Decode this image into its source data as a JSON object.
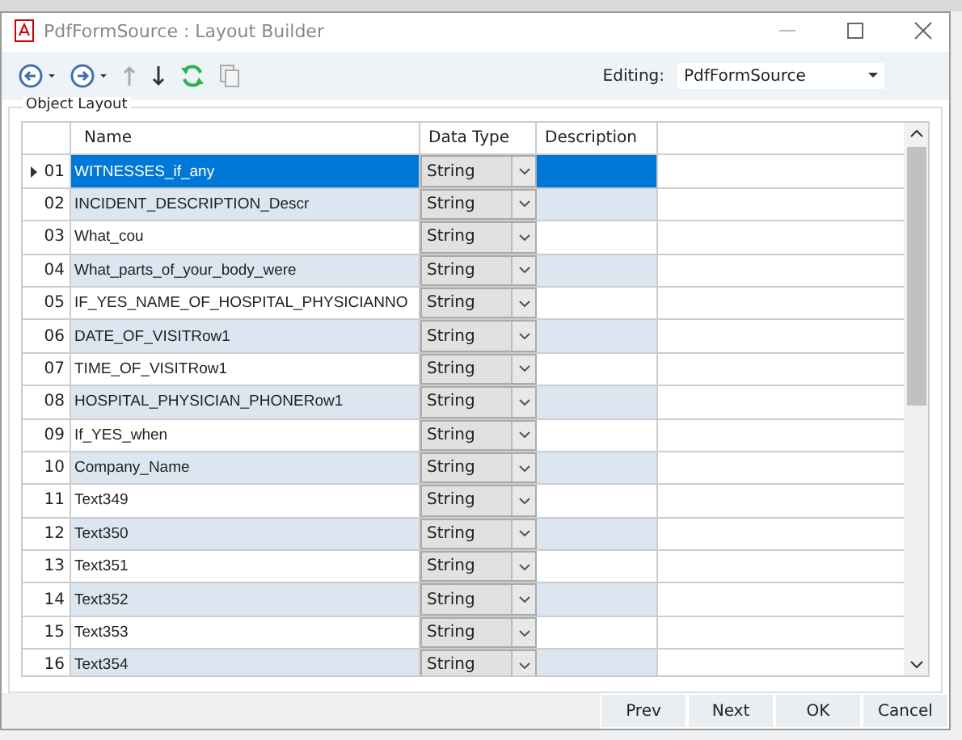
{
  "window": {
    "title": "PdfFormSource : Layout Builder"
  },
  "editing": {
    "label": "Editing:",
    "value": "PdfFormSource"
  },
  "group": {
    "title": "Object Layout"
  },
  "table": {
    "columns": [
      "Name",
      "Data Type",
      "Description"
    ],
    "rows": [
      {
        "index": "01",
        "name": "WITNESSES_if_any",
        "type": "String",
        "selected": true
      },
      {
        "index": "02",
        "name": "INCIDENT_DESCRIPTION_Descr",
        "type": "String",
        "selected": false
      },
      {
        "index": "03",
        "name": "What_cou",
        "type": "String",
        "selected": false
      },
      {
        "index": "04",
        "name": "What_parts_of_your_body_were",
        "type": "String",
        "selected": false
      },
      {
        "index": "05",
        "name": "IF_YES_NAME_OF_HOSPITAL_PHYSICIANNO",
        "type": "String",
        "selected": false
      },
      {
        "index": "06",
        "name": "DATE_OF_VISITRow1",
        "type": "String",
        "selected": false
      },
      {
        "index": "07",
        "name": "TIME_OF_VISITRow1",
        "type": "String",
        "selected": false
      },
      {
        "index": "08",
        "name": "HOSPITAL_PHYSICIAN_PHONERow1",
        "type": "String",
        "selected": false
      },
      {
        "index": "09",
        "name": "If_YES_when",
        "type": "String",
        "selected": false
      },
      {
        "index": "10",
        "name": "Company_Name",
        "type": "String",
        "selected": false
      },
      {
        "index": "11",
        "name": "Text349",
        "type": "String",
        "selected": false
      },
      {
        "index": "12",
        "name": "Text350",
        "type": "String",
        "selected": false
      },
      {
        "index": "13",
        "name": "Text351",
        "type": "String",
        "selected": false
      },
      {
        "index": "14",
        "name": "Text352",
        "type": "String",
        "selected": false
      },
      {
        "index": "15",
        "name": "Text353",
        "type": "String",
        "selected": false
      },
      {
        "index": "16",
        "name": "Text354",
        "type": "String",
        "selected": false
      }
    ]
  },
  "buttons": [
    "Prev",
    "Next",
    "OK",
    "Cancel"
  ]
}
